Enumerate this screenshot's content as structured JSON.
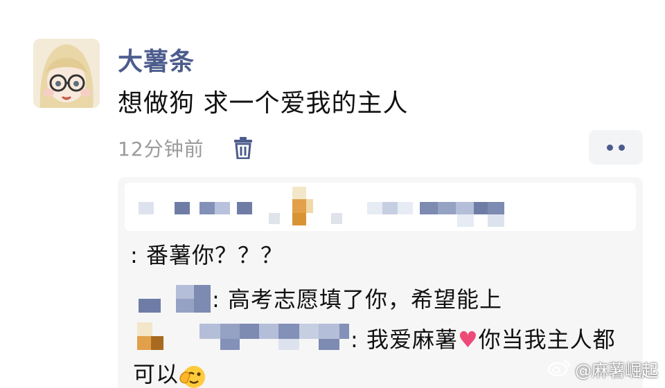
{
  "post": {
    "username": "大薯条",
    "text": "想做狗 求一个爱我的主人",
    "timestamp": "12分钟前",
    "colors": {
      "username": "#4c5c8c",
      "timestamp": "#9a9a9a",
      "panel": "#f6f6f7"
    }
  },
  "icons": {
    "delete": "trash-icon",
    "more": "more-dots-icon",
    "heart": "heart-icon",
    "emoji": "wink-hand-emoji",
    "watermark": "weibo-logo-icon"
  },
  "replies": {
    "line1": ": 番薯你？？？",
    "line2": ": 高考志愿填了你，希望能上",
    "line3_part1": ": 我爱麻薯",
    "line3_part2": "你当我主人都",
    "line3_cont": "可以"
  },
  "watermark": {
    "text": "@麻薯崛起"
  }
}
